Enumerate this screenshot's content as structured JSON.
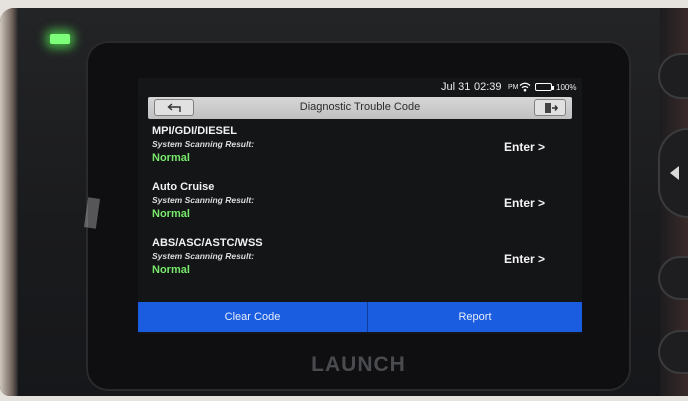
{
  "device": {
    "brand": "LAUNCH"
  },
  "status_bar": {
    "date": "Jul 31",
    "time": "02:39",
    "ampm": "PM",
    "battery": "100%",
    "battery_color": "#3ecd3e"
  },
  "header": {
    "title": "Diagnostic Trouble Code",
    "back_icon": "back-arrow-icon",
    "exit_icon": "exit-icon"
  },
  "systems": [
    {
      "name": "MPI/GDI/DIESEL",
      "label": "System Scanning Result:",
      "status": "Normal",
      "action": "Enter >"
    },
    {
      "name": "Auto Cruise",
      "label": "System Scanning Result:",
      "status": "Normal",
      "action": "Enter >"
    },
    {
      "name": "ABS/ASC/ASTC/WSS",
      "label": "System Scanning Result:",
      "status": "Normal",
      "action": "Enter >"
    }
  ],
  "footer": {
    "clear_label": "Clear Code",
    "report_label": "Report",
    "accent": "#1a5de0"
  },
  "colors": {
    "status_ok": "#76e86a"
  }
}
